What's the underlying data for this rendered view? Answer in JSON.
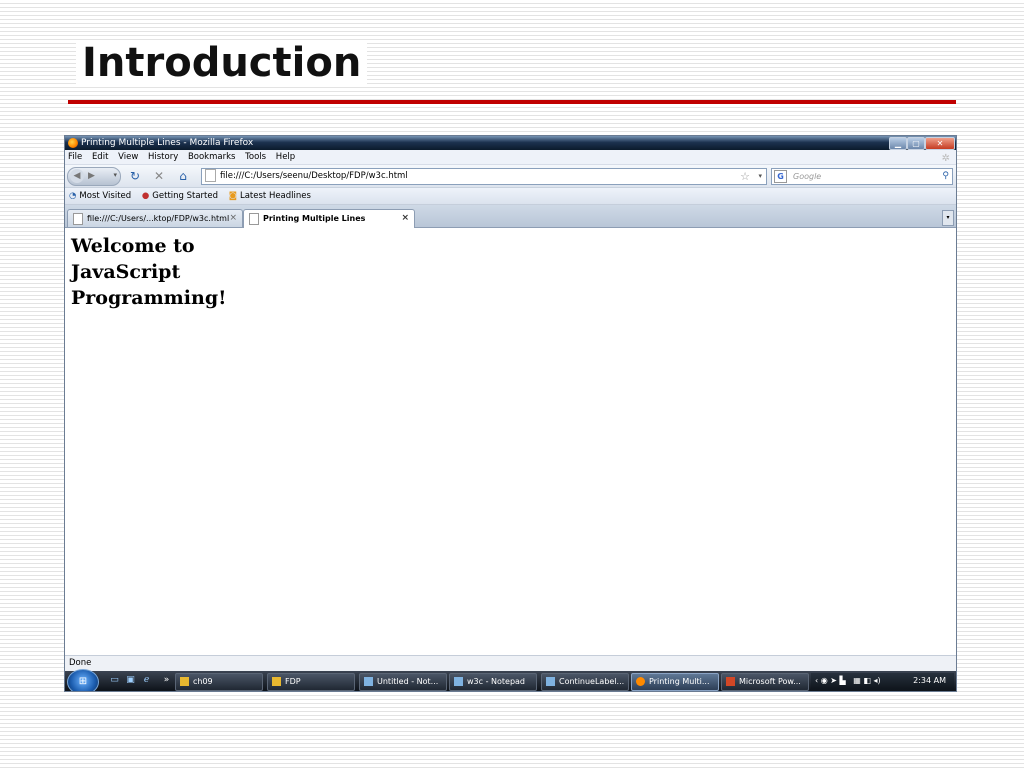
{
  "slide": {
    "title": "Introduction"
  },
  "window": {
    "title": "Printing Multiple Lines - Mozilla Firefox",
    "menu": [
      "File",
      "Edit",
      "View",
      "History",
      "Bookmarks",
      "Tools",
      "Help"
    ],
    "url": "file:///C:/Users/seenu/Desktop/FDP/w3c.html",
    "search_placeholder": "Google",
    "bookmarks": [
      "Most Visited",
      "Getting Started",
      "Latest Headlines"
    ],
    "tabs": [
      {
        "label": "file:///C:/Users/...ktop/FDP/w3c.html",
        "active": false
      },
      {
        "label": "Printing Multiple Lines",
        "active": true
      }
    ],
    "content": {
      "line1": "Welcome to",
      "line2": "JavaScript",
      "line3": "Programming!"
    },
    "status": "Done"
  },
  "taskbar": {
    "items": [
      {
        "label": "ch09",
        "active": false
      },
      {
        "label": "FDP",
        "active": false
      },
      {
        "label": "Untitled - Not...",
        "active": false
      },
      {
        "label": "w3c - Notepad",
        "active": false
      },
      {
        "label": "ContinueLabel...",
        "active": false
      },
      {
        "label": "Printing Multi...",
        "active": true
      },
      {
        "label": "Microsoft Pow...",
        "active": false
      }
    ],
    "clock": "2:34 AM"
  },
  "colors": {
    "accent_rule": "#c00000",
    "titlebar": "#1c3250"
  }
}
